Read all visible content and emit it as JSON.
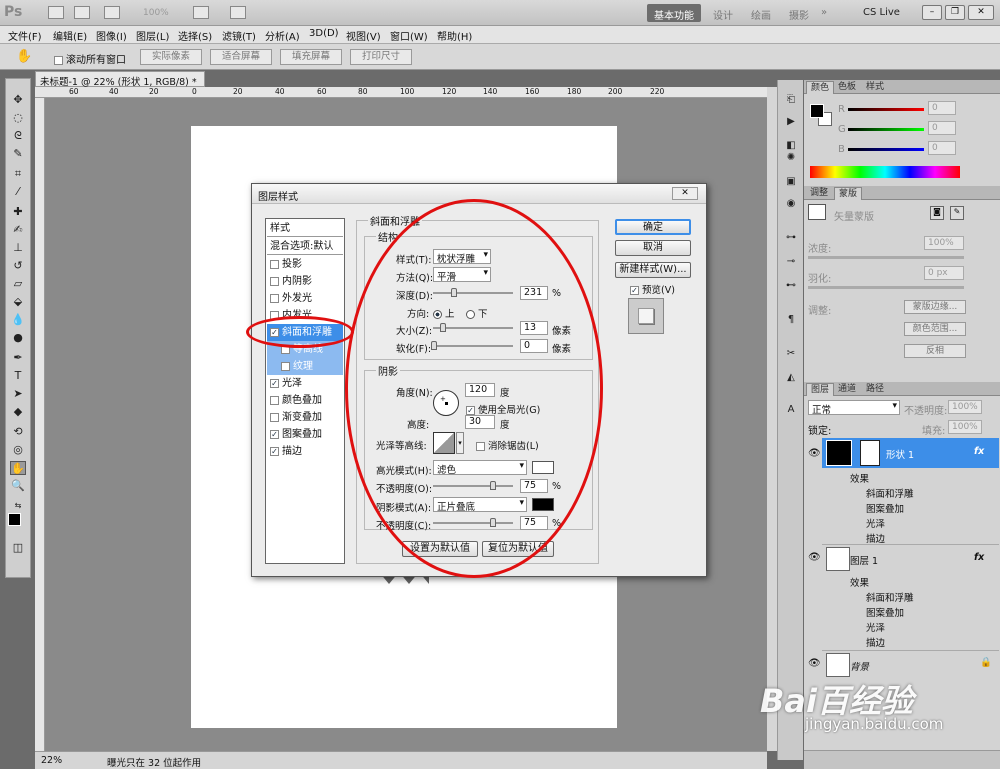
{
  "app": {
    "logo": "Ps",
    "zoom_display": "100%",
    "workspaces": [
      "基本功能",
      "设计",
      "绘画",
      "摄影",
      "»"
    ],
    "cs_live": "CS Live"
  },
  "menu": [
    "文件(F)",
    "编辑(E)",
    "图像(I)",
    "图层(L)",
    "选择(S)",
    "滤镜(T)",
    "分析(A)",
    "3D(D)",
    "视图(V)",
    "窗口(W)",
    "帮助(H)"
  ],
  "options": {
    "scroll_all": "滚动所有窗口",
    "buttons": [
      "实际像素",
      "适合屏幕",
      "填充屏幕",
      "打印尺寸"
    ]
  },
  "document": {
    "tab": "未标题-1 @ 22% (形状 1, RGB/8) *",
    "ruler_ticks": [
      "60",
      "40",
      "20",
      "0",
      "20",
      "40",
      "60",
      "80",
      "100",
      "120",
      "140",
      "160",
      "180",
      "200",
      "220"
    ],
    "zoom": "22%",
    "status": "曝光只在 32 位起作用"
  },
  "dialog": {
    "title": "图层样式",
    "styles_header": "样式",
    "blend_default": "混合选项:默认",
    "items": [
      {
        "label": "投影",
        "checked": false
      },
      {
        "label": "内阴影",
        "checked": false
      },
      {
        "label": "外发光",
        "checked": false
      },
      {
        "label": "内发光",
        "checked": false
      },
      {
        "label": "斜面和浮雕",
        "checked": true,
        "selected": true
      },
      {
        "label": "等高线",
        "checked": false,
        "sub": true
      },
      {
        "label": "纹理",
        "checked": false,
        "sub": true
      },
      {
        "label": "光泽",
        "checked": true
      },
      {
        "label": "颜色叠加",
        "checked": false
      },
      {
        "label": "渐变叠加",
        "checked": false
      },
      {
        "label": "图案叠加",
        "checked": true
      },
      {
        "label": "描边",
        "checked": true
      }
    ],
    "bevel_title": "斜面和浮雕",
    "structure_title": "结构",
    "style_label": "样式(T):",
    "style_value": "枕状浮雕",
    "technique_label": "方法(Q):",
    "technique_value": "平滑",
    "depth_label": "深度(D):",
    "depth_value": "231",
    "depth_unit": "%",
    "direction_label": "方向:",
    "dir_up": "上",
    "dir_down": "下",
    "size_label": "大小(Z):",
    "size_value": "13",
    "size_unit": "像素",
    "soften_label": "软化(F):",
    "soften_value": "0",
    "soften_unit": "像素",
    "shading_title": "阴影",
    "angle_label": "角度(N):",
    "angle_value": "120",
    "angle_unit": "度",
    "global_light": "使用全局光(G)",
    "altitude_label": "高度:",
    "altitude_value": "30",
    "altitude_unit": "度",
    "gloss_label": "光泽等高线:",
    "antialias": "消除锯齿(L)",
    "highlight_label": "高光模式(H):",
    "highlight_value": "滤色",
    "hl_opacity_label": "不透明度(O):",
    "hl_opacity_value": "75",
    "hl_opacity_unit": "%",
    "shadow_label": "阴影模式(A):",
    "shadow_value": "正片叠底",
    "sh_opacity_label": "不透明度(C):",
    "sh_opacity_value": "75",
    "sh_opacity_unit": "%",
    "make_default": "设置为默认值",
    "reset_default": "复位为默认值",
    "ok": "确定",
    "cancel": "取消",
    "new_style": "新建样式(W)...",
    "preview": "预览(V)",
    "highlight_color": "#ffffff",
    "shadow_color": "#000000"
  },
  "color_panel": {
    "tabs": [
      "颜色",
      "色板",
      "样式"
    ],
    "channels": [
      {
        "name": "R",
        "value": "0"
      },
      {
        "name": "G",
        "value": "0"
      },
      {
        "name": "B",
        "value": "0"
      }
    ]
  },
  "adjust_panel": {
    "tabs": [
      "调整",
      "蒙版"
    ],
    "mask_label": "矢量蒙版",
    "density_label": "浓度:",
    "density_value": "100%",
    "feather_label": "羽化:",
    "feather_value": "0 px",
    "refine_label": "调整:",
    "buttons": [
      "蒙版边缘...",
      "颜色范围...",
      "反相"
    ]
  },
  "layers_panel": {
    "tabs": [
      "图层",
      "通道",
      "路径"
    ],
    "blend": "正常",
    "opacity_label": "不透明度:",
    "opacity_value": "100%",
    "lock_label": "锁定:",
    "fill_label": "填充:",
    "fill_value": "100%",
    "layers": [
      {
        "name": "形状 1",
        "fx": "fx",
        "effects_label": "效果",
        "effects": [
          "斜面和浮雕",
          "图案叠加",
          "光泽",
          "描边"
        ]
      },
      {
        "name": "图层 1",
        "fx": "fx",
        "effects_label": "效果",
        "effects": [
          "斜面和浮雕",
          "图案叠加",
          "光泽",
          "描边"
        ]
      },
      {
        "name": "背景"
      }
    ]
  },
  "watermark": {
    "logo": "Bai百经验",
    "url": "jingyan.baidu.com"
  },
  "colors": {
    "highlight_red": "#e01010",
    "selection_blue": "#3d8ee8"
  }
}
